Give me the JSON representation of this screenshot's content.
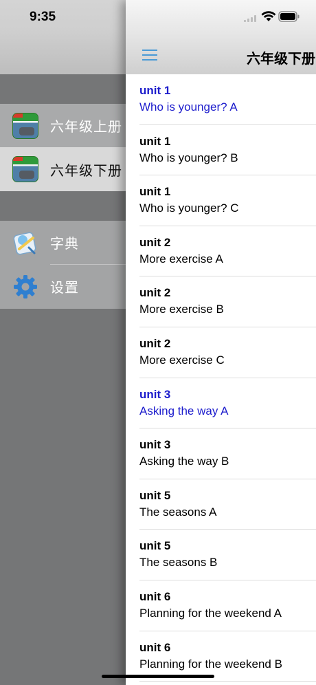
{
  "status_bar": {
    "time": "9:35"
  },
  "side_menu": {
    "books": [
      {
        "label": "六年级上册",
        "icon": "textbook-icon",
        "selected": false
      },
      {
        "label": "六年级下册",
        "icon": "textbook-icon",
        "selected": true
      }
    ],
    "tools": [
      {
        "label": "字典",
        "icon": "dictionary-icon"
      },
      {
        "label": "设置",
        "icon": "gear-icon"
      }
    ]
  },
  "nav": {
    "title": "六年级下册",
    "menu_icon": "hamburger-icon"
  },
  "lessons": [
    {
      "unit": "unit 1",
      "title": "Who is younger? A",
      "active": true
    },
    {
      "unit": "unit 1",
      "title": "Who is younger? B",
      "active": false
    },
    {
      "unit": "unit 1",
      "title": "Who is younger? C",
      "active": false
    },
    {
      "unit": "unit 2",
      "title": "More exercise A",
      "active": false
    },
    {
      "unit": "unit 2",
      "title": "More exercise B",
      "active": false
    },
    {
      "unit": "unit 2",
      "title": "More exercise C",
      "active": false
    },
    {
      "unit": "unit 3",
      "title": "Asking the way A",
      "active": true
    },
    {
      "unit": "unit 3",
      "title": "Asking the way B",
      "active": false
    },
    {
      "unit": "unit 5",
      "title": "The seasons A",
      "active": false
    },
    {
      "unit": "unit 5",
      "title": "The seasons B",
      "active": false
    },
    {
      "unit": "unit 6",
      "title": "Planning for the weekend A",
      "active": false
    },
    {
      "unit": "unit 6",
      "title": "Planning for the weekend B",
      "active": false
    }
  ],
  "colors": {
    "active_text": "#1c1ccc",
    "accent_icon": "#4a9ad6"
  }
}
